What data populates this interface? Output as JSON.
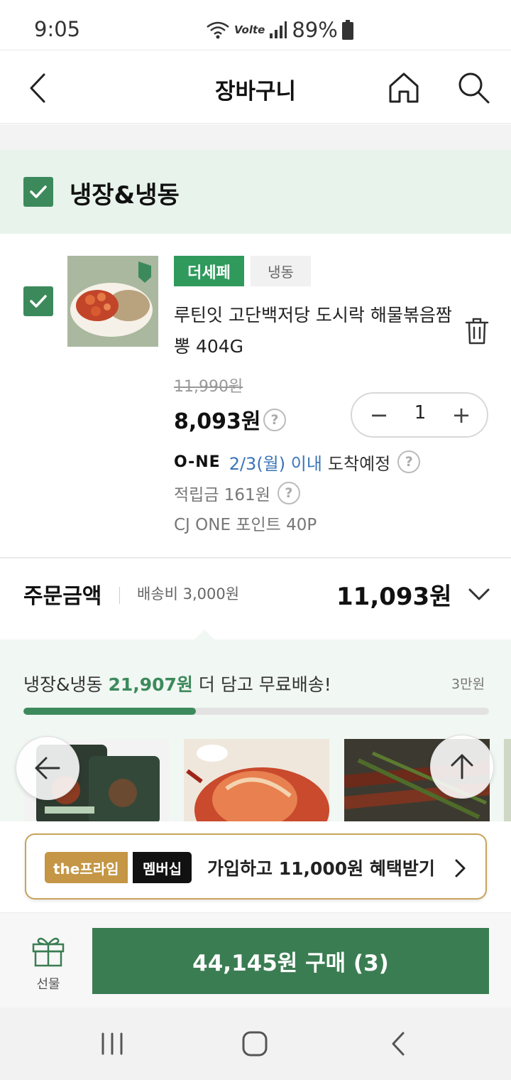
{
  "status_bar": {
    "time": "9:05",
    "volte": "Volte",
    "battery": "89%"
  },
  "header": {
    "title": "장바구니"
  },
  "category": {
    "title": "냉장&냉동"
  },
  "product": {
    "brand_badge": "더세페",
    "type_badge": "냉동",
    "name": "루틴잇 고단백저당 도시락 해물볶음짬뽕 404G",
    "original_price": "11,990원",
    "sale_price": "8,093원",
    "quantity": "1",
    "delivery_logo": "O-NE",
    "delivery_date": "2/3(월) 이내",
    "delivery_text": "도착예정",
    "points": "적립금 161원",
    "cj_one": "CJ ONE 포인트 40P",
    "help_glyph": "?",
    "minus_glyph": "−",
    "plus_glyph": "+"
  },
  "order": {
    "label": "주문금액",
    "shipping": "배송비 3,000원",
    "total": "11,093원"
  },
  "free_shipping": {
    "prefix": "냉장&냉동",
    "amount": "21,907원",
    "suffix": "더 담고 무료배송!",
    "goal": "3만원",
    "progress": 0.37
  },
  "membership": {
    "tag1": "the프라임",
    "tag2": "멤버십",
    "text": "가입하고 11,000원 혜택받기"
  },
  "bottom": {
    "gift_label": "선물",
    "buy_label": "44,145원 구매 (3)"
  },
  "colors": {
    "accent": "#3c8a5b",
    "category_bg": "#e8f3ec",
    "buy_button": "#3a7d52",
    "membership_gold": "#c49645",
    "delivery_date": "#3a74b8"
  }
}
